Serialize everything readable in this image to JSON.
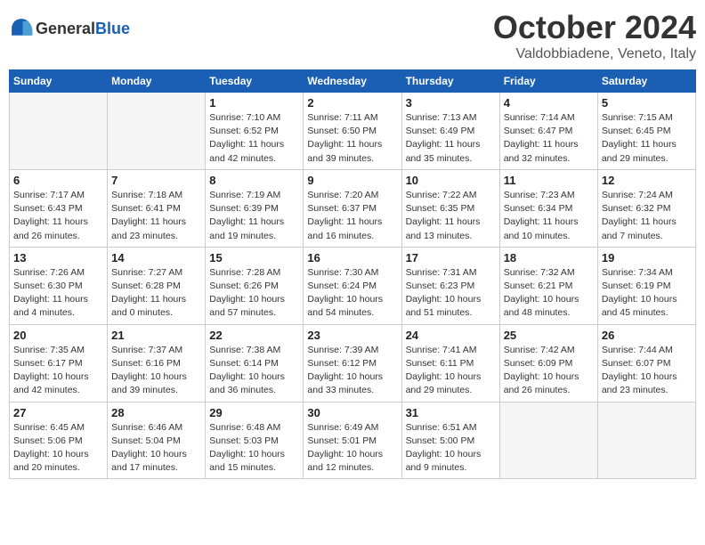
{
  "header": {
    "logo_general": "General",
    "logo_blue": "Blue",
    "month": "October 2024",
    "location": "Valdobbiadene, Veneto, Italy"
  },
  "days_of_week": [
    "Sunday",
    "Monday",
    "Tuesday",
    "Wednesday",
    "Thursday",
    "Friday",
    "Saturday"
  ],
  "weeks": [
    [
      {
        "day": "",
        "info": ""
      },
      {
        "day": "",
        "info": ""
      },
      {
        "day": "1",
        "sunrise": "7:10 AM",
        "sunset": "6:52 PM",
        "daylight": "11 hours and 42 minutes."
      },
      {
        "day": "2",
        "sunrise": "7:11 AM",
        "sunset": "6:50 PM",
        "daylight": "11 hours and 39 minutes."
      },
      {
        "day": "3",
        "sunrise": "7:13 AM",
        "sunset": "6:49 PM",
        "daylight": "11 hours and 35 minutes."
      },
      {
        "day": "4",
        "sunrise": "7:14 AM",
        "sunset": "6:47 PM",
        "daylight": "11 hours and 32 minutes."
      },
      {
        "day": "5",
        "sunrise": "7:15 AM",
        "sunset": "6:45 PM",
        "daylight": "11 hours and 29 minutes."
      }
    ],
    [
      {
        "day": "6",
        "sunrise": "7:17 AM",
        "sunset": "6:43 PM",
        "daylight": "11 hours and 26 minutes."
      },
      {
        "day": "7",
        "sunrise": "7:18 AM",
        "sunset": "6:41 PM",
        "daylight": "11 hours and 23 minutes."
      },
      {
        "day": "8",
        "sunrise": "7:19 AM",
        "sunset": "6:39 PM",
        "daylight": "11 hours and 19 minutes."
      },
      {
        "day": "9",
        "sunrise": "7:20 AM",
        "sunset": "6:37 PM",
        "daylight": "11 hours and 16 minutes."
      },
      {
        "day": "10",
        "sunrise": "7:22 AM",
        "sunset": "6:35 PM",
        "daylight": "11 hours and 13 minutes."
      },
      {
        "day": "11",
        "sunrise": "7:23 AM",
        "sunset": "6:34 PM",
        "daylight": "11 hours and 10 minutes."
      },
      {
        "day": "12",
        "sunrise": "7:24 AM",
        "sunset": "6:32 PM",
        "daylight": "11 hours and 7 minutes."
      }
    ],
    [
      {
        "day": "13",
        "sunrise": "7:26 AM",
        "sunset": "6:30 PM",
        "daylight": "11 hours and 4 minutes."
      },
      {
        "day": "14",
        "sunrise": "7:27 AM",
        "sunset": "6:28 PM",
        "daylight": "11 hours and 0 minutes."
      },
      {
        "day": "15",
        "sunrise": "7:28 AM",
        "sunset": "6:26 PM",
        "daylight": "10 hours and 57 minutes."
      },
      {
        "day": "16",
        "sunrise": "7:30 AM",
        "sunset": "6:24 PM",
        "daylight": "10 hours and 54 minutes."
      },
      {
        "day": "17",
        "sunrise": "7:31 AM",
        "sunset": "6:23 PM",
        "daylight": "10 hours and 51 minutes."
      },
      {
        "day": "18",
        "sunrise": "7:32 AM",
        "sunset": "6:21 PM",
        "daylight": "10 hours and 48 minutes."
      },
      {
        "day": "19",
        "sunrise": "7:34 AM",
        "sunset": "6:19 PM",
        "daylight": "10 hours and 45 minutes."
      }
    ],
    [
      {
        "day": "20",
        "sunrise": "7:35 AM",
        "sunset": "6:17 PM",
        "daylight": "10 hours and 42 minutes."
      },
      {
        "day": "21",
        "sunrise": "7:37 AM",
        "sunset": "6:16 PM",
        "daylight": "10 hours and 39 minutes."
      },
      {
        "day": "22",
        "sunrise": "7:38 AM",
        "sunset": "6:14 PM",
        "daylight": "10 hours and 36 minutes."
      },
      {
        "day": "23",
        "sunrise": "7:39 AM",
        "sunset": "6:12 PM",
        "daylight": "10 hours and 33 minutes."
      },
      {
        "day": "24",
        "sunrise": "7:41 AM",
        "sunset": "6:11 PM",
        "daylight": "10 hours and 29 minutes."
      },
      {
        "day": "25",
        "sunrise": "7:42 AM",
        "sunset": "6:09 PM",
        "daylight": "10 hours and 26 minutes."
      },
      {
        "day": "26",
        "sunrise": "7:44 AM",
        "sunset": "6:07 PM",
        "daylight": "10 hours and 23 minutes."
      }
    ],
    [
      {
        "day": "27",
        "sunrise": "6:45 AM",
        "sunset": "5:06 PM",
        "daylight": "10 hours and 20 minutes."
      },
      {
        "day": "28",
        "sunrise": "6:46 AM",
        "sunset": "5:04 PM",
        "daylight": "10 hours and 17 minutes."
      },
      {
        "day": "29",
        "sunrise": "6:48 AM",
        "sunset": "5:03 PM",
        "daylight": "10 hours and 15 minutes."
      },
      {
        "day": "30",
        "sunrise": "6:49 AM",
        "sunset": "5:01 PM",
        "daylight": "10 hours and 12 minutes."
      },
      {
        "day": "31",
        "sunrise": "6:51 AM",
        "sunset": "5:00 PM",
        "daylight": "10 hours and 9 minutes."
      },
      {
        "day": "",
        "info": ""
      },
      {
        "day": "",
        "info": ""
      }
    ]
  ],
  "labels": {
    "sunrise": "Sunrise:",
    "sunset": "Sunset:",
    "daylight": "Daylight:"
  }
}
